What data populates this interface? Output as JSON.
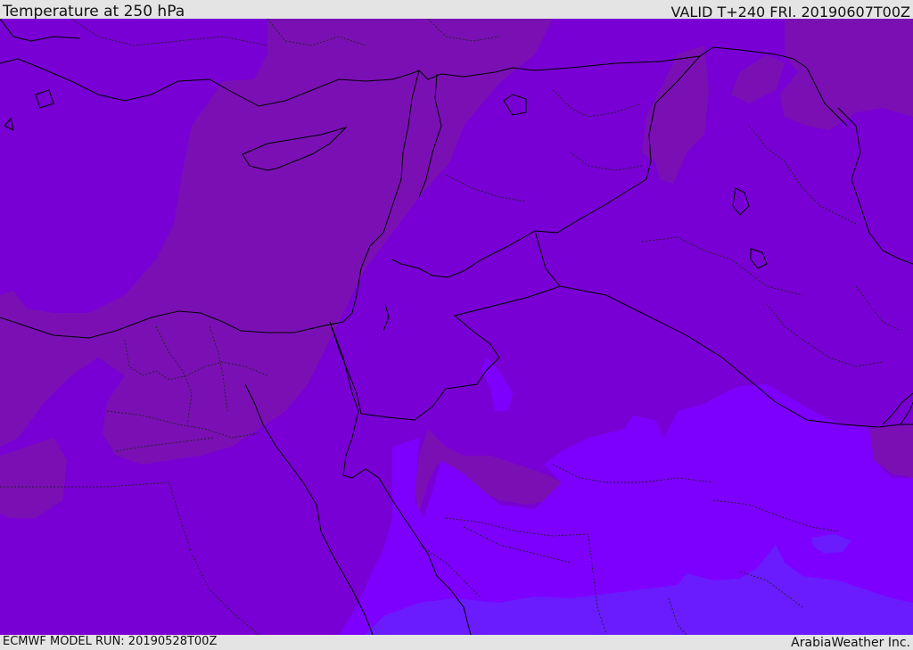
{
  "header": {
    "title": "Temperature at 250 hPa",
    "valid_time": "VALID T+240 FRI. 20190607T00Z"
  },
  "footer": {
    "model_run": "ECMWF MODEL RUN: 20190528T00Z",
    "credit": "ArabiaWeather Inc."
  },
  "colors": {
    "band_warmest": "#7a10b4",
    "band_warm": "#7800d4",
    "band_mid": "#7d00ff",
    "band_cool": "#6a1cff",
    "coastline": "#000000",
    "border": "#000000",
    "province_border": "#222222"
  }
}
